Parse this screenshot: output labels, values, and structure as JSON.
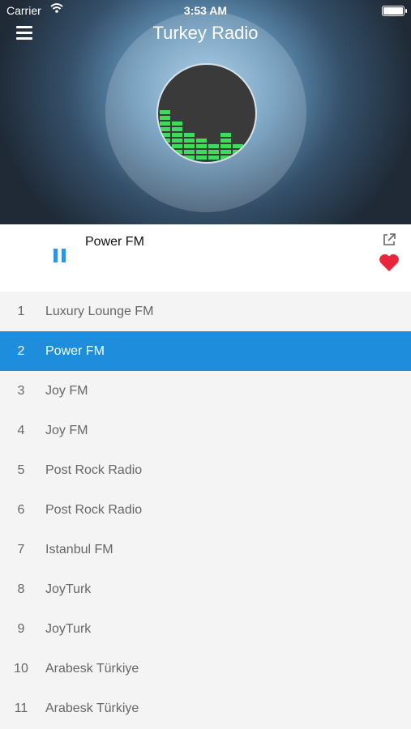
{
  "status_bar": {
    "carrier": "Carrier",
    "time": "3:53 AM"
  },
  "header": {
    "title": "Turkey Radio"
  },
  "player": {
    "station": "Power FM",
    "state": "playing"
  },
  "colors": {
    "accent": "#1e8edc",
    "heart": "#e8273c",
    "equalizer": "#3ddc5a"
  },
  "stations": [
    {
      "num": "1",
      "name": "Luxury Lounge FM",
      "selected": false
    },
    {
      "num": "2",
      "name": "Power FM",
      "selected": true
    },
    {
      "num": "3",
      "name": "Joy FM",
      "selected": false
    },
    {
      "num": "4",
      "name": "Joy FM",
      "selected": false
    },
    {
      "num": "5",
      "name": "Post Rock Radio",
      "selected": false
    },
    {
      "num": "6",
      "name": "Post Rock Radio",
      "selected": false
    },
    {
      "num": "7",
      "name": "Istanbul FM",
      "selected": false
    },
    {
      "num": "8",
      "name": "JoyTurk",
      "selected": false
    },
    {
      "num": "9",
      "name": "JoyTurk",
      "selected": false
    },
    {
      "num": "10",
      "name": "Arabesk Türkiye",
      "selected": false
    },
    {
      "num": "11",
      "name": "Arabesk Türkiye",
      "selected": false
    }
  ]
}
